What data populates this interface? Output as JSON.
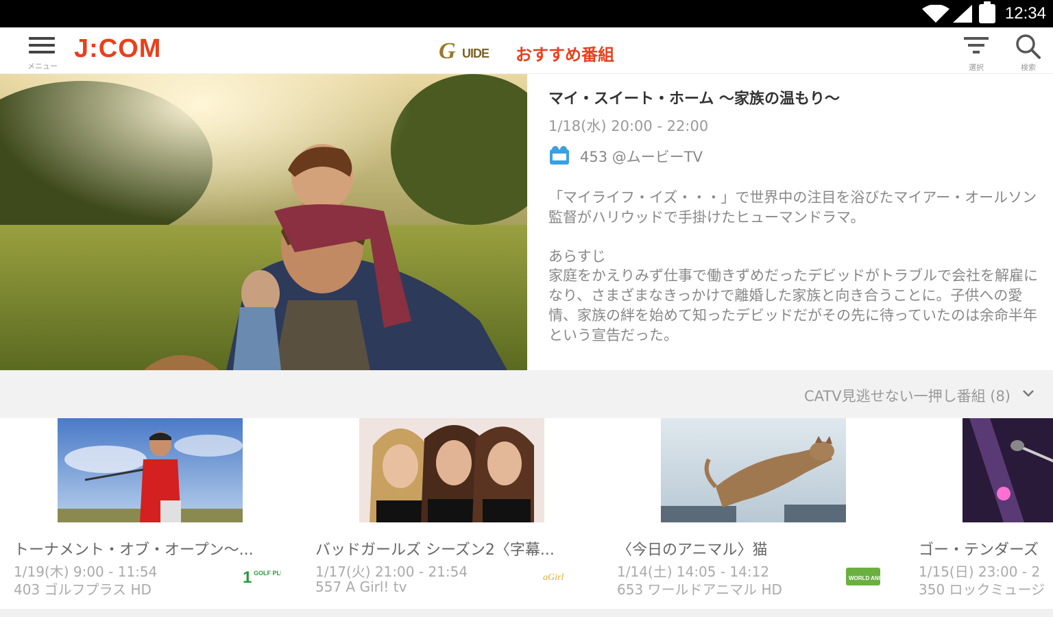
{
  "status_bar": {
    "time": "12:34"
  },
  "app_bar": {
    "menu_label": "メニュー",
    "logo": "J:COM",
    "guide_logo": "G GUIDE",
    "title": "おすすめ番組",
    "filter_label": "選択",
    "search_label": "検索"
  },
  "hero": {
    "title": "マイ・スイート・ホーム 〜家族の温もり〜",
    "time": "1/18(水) 20:00 - 22:00",
    "channel": "453 @ムービーTV",
    "description": "「マイライフ・イズ・・・」で世界中の注目を浴びたマイアー・オールソン監督がハリウッドで手掛けたヒューマンドラマ。",
    "synopsis_title": "あらすじ",
    "synopsis": "家庭をかえりみず仕事で働きずめだったデビッドがトラブルで会社を解雇になり、さまざまなきっかけで離婚した家族と向き合うことに。子供への愛情、家族の絆を始めて知ったデビッドだがその先に待っていたのは余命半年という宣告だった。"
  },
  "category": {
    "label": "CATV見逃せない一押し番組 (8)"
  },
  "cards": [
    {
      "title": "トーナメント・オブ・オープン〜...",
      "time": "1/19(木) 9:00 - 11:54",
      "channel": "403 ゴルフプラス HD",
      "channel_logo": "GOLF PLUS"
    },
    {
      "title": "バッドガールズ シーズン2〈字幕...",
      "time": "1/17(火) 21:00 - 21:54",
      "channel": "557 A Girl! tv",
      "channel_logo": "aGirl"
    },
    {
      "title": "〈今日のアニマル〉猫",
      "time": "1/14(土) 14:05 - 14:12",
      "channel": "653 ワールドアニマル HD",
      "channel_logo": "WORLD ANIMAL"
    },
    {
      "title": "ゴー・テンダーズ",
      "time": "1/15(日) 23:00 - 2",
      "channel": "350 ロックミュージ",
      "channel_logo": ""
    }
  ],
  "colors": {
    "accent": "#e8401c",
    "guide_gold": "#9a7a2c",
    "channel_blue": "#3aa0e0"
  }
}
